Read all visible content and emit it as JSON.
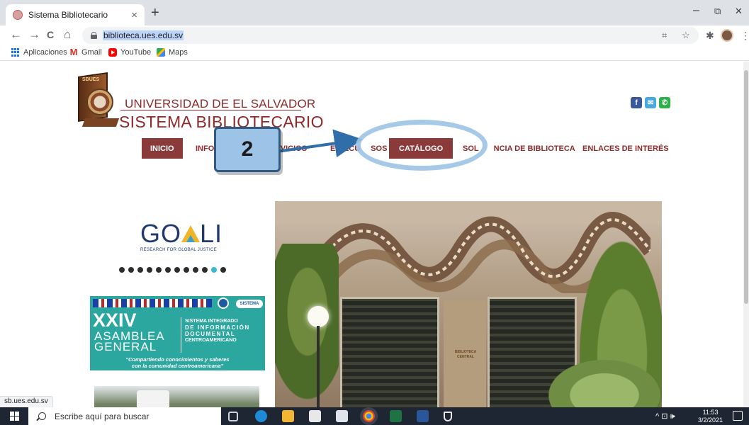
{
  "browser": {
    "tab_title": "Sistema Bibliotecario",
    "tab_close": "×",
    "new_tab": "+",
    "window_controls": {
      "minimize": "–",
      "restore": "⧉",
      "close": "✕"
    },
    "url": "biblioteca.ues.edu.sv",
    "nav": {
      "back": "←",
      "forward": "→",
      "reload": "C",
      "home": "⌂"
    },
    "bookmarks": [
      {
        "label": "Aplicaciones",
        "icon": "apps-icon"
      },
      {
        "label": "Gmail",
        "icon": "gmail-icon"
      },
      {
        "label": "YouTube",
        "icon": "youtube-icon"
      },
      {
        "label": "Maps",
        "icon": "maps-icon"
      }
    ]
  },
  "site": {
    "university": "UNIVERSIDAD DE EL SALVADOR",
    "system": "SISTEMA BIBLIOTECARIO",
    "logo_text": "SBUES",
    "social": [
      {
        "label": "f",
        "name": "facebook-icon",
        "color": "#3b5998"
      },
      {
        "label": "✉",
        "name": "mail-icon",
        "color": "#4aa8e0"
      },
      {
        "label": "✆",
        "name": "phone-icon",
        "color": "#2fb14a"
      }
    ],
    "menu": {
      "inicio": "INICIO",
      "info": "INFO",
      "servicios": "RVICIOS",
      "erecursos": "E-RECU",
      "erecursos_end": "SOS",
      "catalogo": "CATÁLOGO",
      "solvencia": "SOL",
      "solvencia_end": "NCIA DE BIBLIOTECA",
      "enlaces": "ENLACES DE INTERÉS"
    },
    "annotation": {
      "number": "2",
      "color": "#9dc3e6",
      "border": "#2f5b82"
    },
    "sidebar": {
      "goali_pre": "GO",
      "goali_post": "LI",
      "goali_sub": "RESEARCH FOR GLOBAL JUSTICE",
      "carousel_count": 12,
      "carousel_active": 11,
      "banner": {
        "sica": "SISTEMA",
        "xxiv": "XXIV",
        "asamblea": "ASAMBLEA",
        "general": "GENERAL",
        "line1": "SISTEMA INTEGRADO",
        "line2": "DE INFORMACIÓN",
        "line3": "DOCUMENTAL",
        "line4": "CENTROAMERICANO",
        "slogan1": "\"Compartiendo conocimientos y saberes",
        "slogan2": "con la comunidad centroamericana\""
      }
    },
    "hero_plaque": "BIBLIOTECA CENTRAL"
  },
  "status_bar_url": "sb.ues.edu.sv",
  "taskbar": {
    "search_placeholder": "Escribe aquí para buscar",
    "time": "11:53",
    "date": "3/2/2021",
    "tray": "^ ⊡ 🕪"
  }
}
